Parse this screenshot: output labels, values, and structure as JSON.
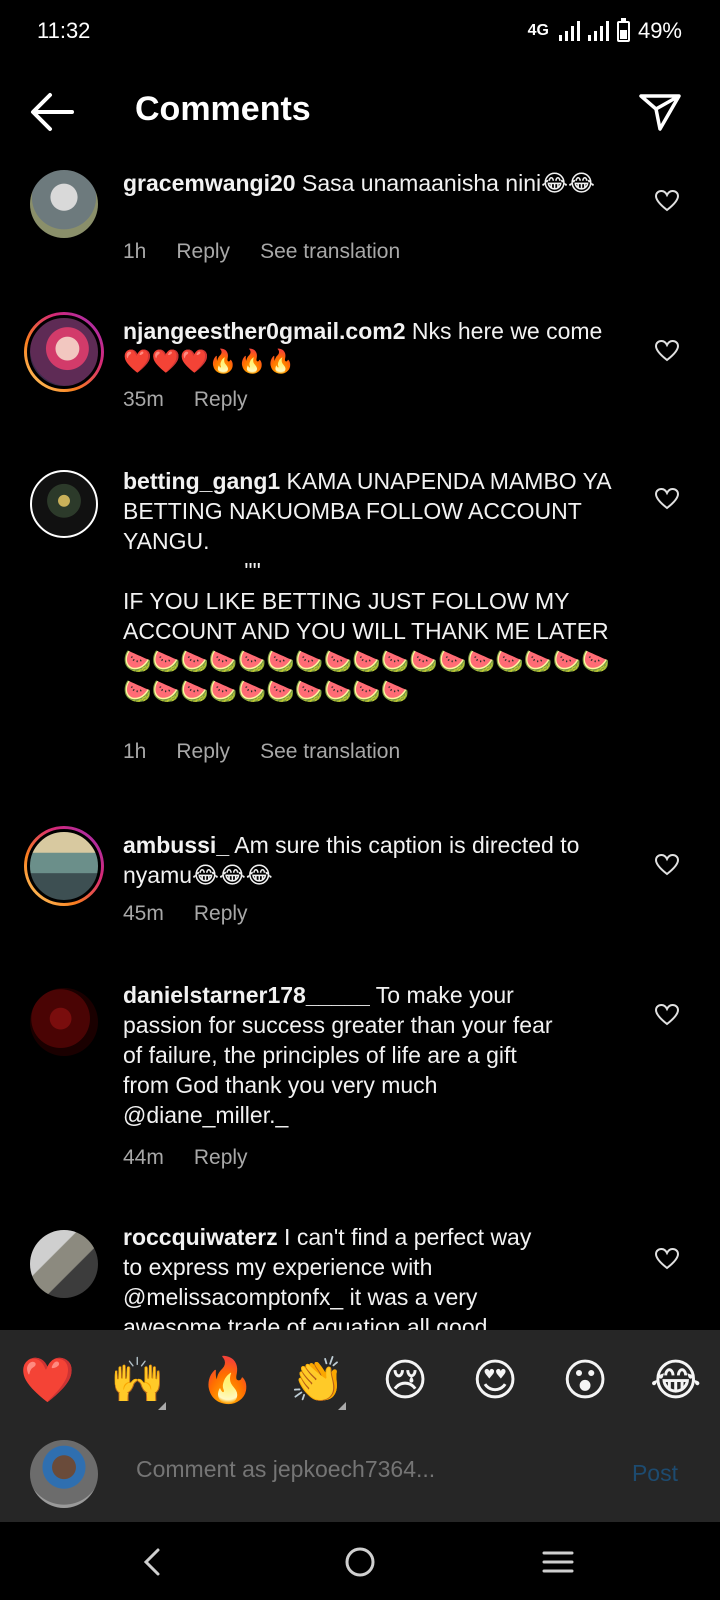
{
  "status_bar": {
    "time": "11:32",
    "network": "4G",
    "battery": "49%",
    "battery_level": 0.49
  },
  "header": {
    "title": "Comments"
  },
  "comments": [
    {
      "username": "gracemwangi20",
      "text": " Sasa unamaanisha nini😂😂",
      "time": "1h",
      "reply": "Reply",
      "translate": "See translation"
    },
    {
      "username": "njangeesther0gmail.com2",
      "text": " Nks here we come❤️❤️❤️🔥🔥🔥",
      "time": "35m",
      "reply": "Reply"
    },
    {
      "username": "betting_gang1",
      "text": " KAMA UNAPENDA MAMBO YA BETTING NAKUOMBA FOLLOW ACCOUNT YANGU.\n                   \"\"\nIF YOU LIKE BETTING JUST FOLLOW MY ACCOUNT AND YOU WILL THANK ME LATER\n🍉🍉🍉🍉🍉🍉🍉🍉🍉🍉🍉🍉🍉🍉🍉🍉🍉🍉🍉🍉🍉🍉🍉🍉🍉🍉🍉",
      "time": "1h",
      "reply": "Reply",
      "translate": "See translation"
    },
    {
      "username": "ambussi_",
      "text": " Am sure this caption is directed to nyamu😂😂😂",
      "time": "45m",
      "reply": "Reply"
    },
    {
      "username": "danielstarner178_____",
      "text": " To make your passion for success greater than your fear of failure, the principles of life are a gift from God thank you very much @diane_miller._",
      "time": "44m",
      "reply": "Reply"
    },
    {
      "username": "roccquiwaterz",
      "text": " I can't find a perfect way to express my experience with @melissacomptonfx_ it was a very awesome trade of equation all good",
      "time": "",
      "reply": ""
    }
  ],
  "emoji_bar": [
    "❤️",
    "🙌",
    "🔥",
    "👏",
    "😢",
    "😍",
    "😮",
    "😂"
  ],
  "composer": {
    "placeholder": "Comment as jepkoech7364...",
    "post_label": "Post"
  },
  "icons": {
    "back": "arrow-left-icon",
    "send": "paper-plane-icon",
    "like": "heart-outline-icon"
  }
}
